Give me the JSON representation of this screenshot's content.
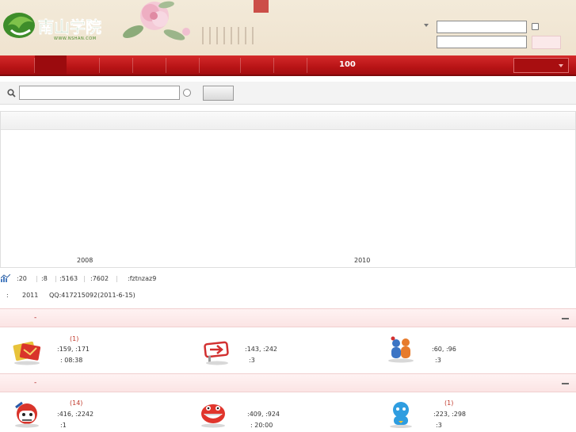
{
  "header": {
    "logo_text": "南山学院",
    "logo_url_text": "WWW.NSHAN.COM",
    "username_field": "",
    "password_field": ""
  },
  "nav": {
    "highlight_count": "100"
  },
  "search": {
    "query": ""
  },
  "chart_data": {
    "type": "line",
    "x_ticks": [
      "2008",
      "2010"
    ],
    "series": []
  },
  "stats": {
    "items": [
      ":20",
      ":8",
      ":5163",
      ":7602",
      ":fztnzaz9"
    ]
  },
  "notice": {
    "year": "2011",
    "qq": "QQ:417215092(2011-6-15)"
  },
  "groups": [
    {
      "title": "-",
      "forums": [
        {
          "new": "(1)",
          "counts": ":159,  :171",
          "last": ":    08:38",
          "icon": "red-envelope-icon"
        },
        {
          "new": "",
          "counts": ":143,  :242",
          "last": ":3",
          "icon": "arrow-sign-icon"
        },
        {
          "new": "",
          "counts": ":60,  :96",
          "last": ":3",
          "icon": "people-icon"
        }
      ]
    },
    {
      "title": "-",
      "forums": [
        {
          "new": "(14)",
          "counts": ":416,  :2242",
          "last": ":1",
          "icon": "angry-face-icon"
        },
        {
          "new": "",
          "counts": ":409,  :924",
          "last": ":    20:00",
          "icon": "grin-face-icon"
        },
        {
          "new": "(1)",
          "counts": ":223,  :298",
          "last": ":3",
          "icon": "robot-icon"
        }
      ]
    }
  ]
}
